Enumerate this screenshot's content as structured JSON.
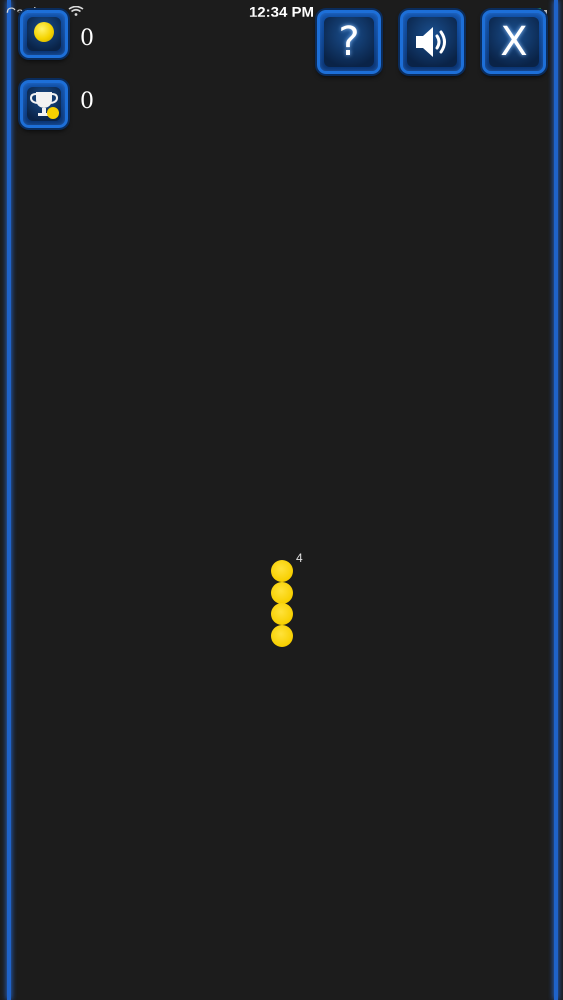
{
  "status_bar": {
    "carrier": "Carrier",
    "time": "12:34 PM"
  },
  "hud": {
    "coins": "0",
    "best_score": "0"
  },
  "buttons": {
    "help_label": "?",
    "sound_icon": "speaker-icon",
    "close_label": "X"
  },
  "snake": {
    "length_label": "4",
    "segments": 4
  },
  "colors": {
    "background": "#1c1c1c",
    "frame_blue": "#1d6fd8",
    "snake_yellow": "#f7cf00",
    "battery_green": "#3ed65a"
  }
}
